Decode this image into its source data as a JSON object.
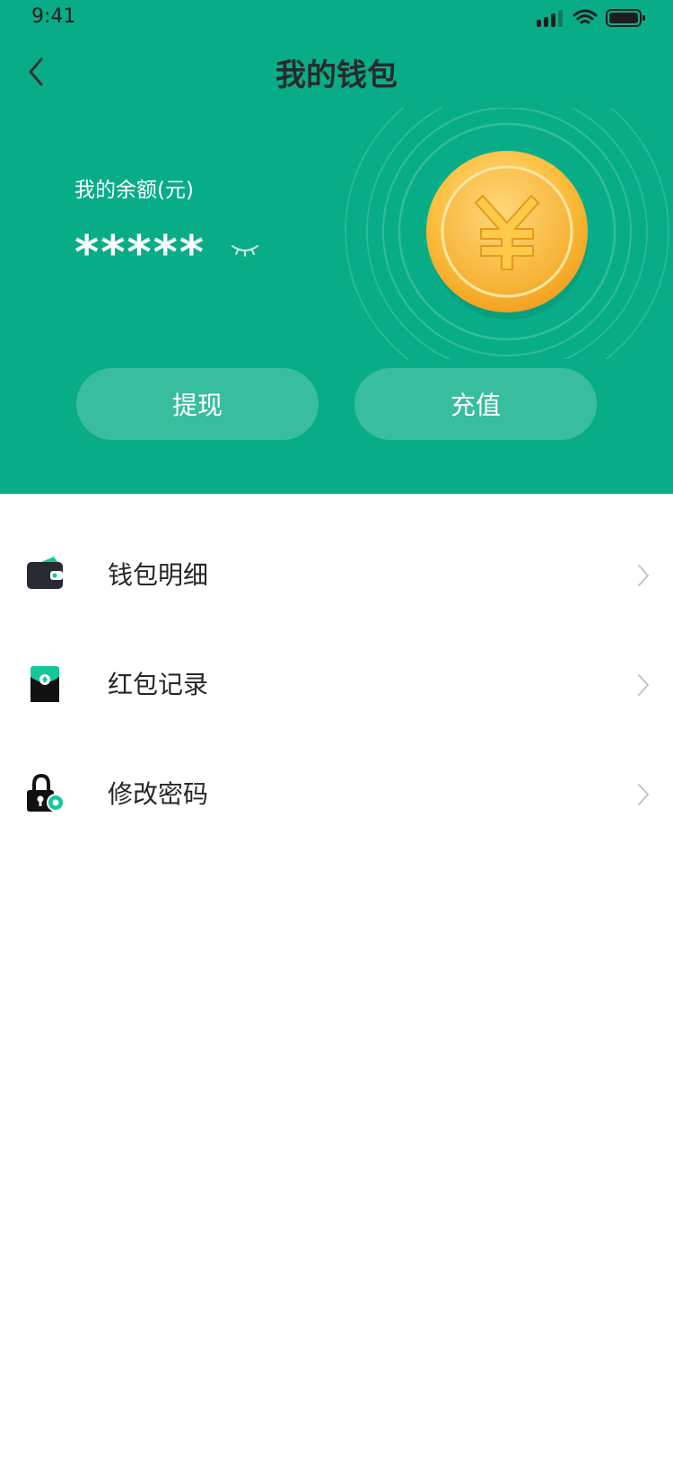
{
  "status_bar": {
    "time": "9:41"
  },
  "header": {
    "title": "我的钱包",
    "balance_label": "我的余额(元)",
    "balance_masked": "*****",
    "bg_color": "#08ad88"
  },
  "actions": {
    "withdraw_label": "提现",
    "recharge_label": "充值"
  },
  "menu": {
    "items": [
      {
        "label": "钱包明细",
        "icon": "wallet-icon"
      },
      {
        "label": "红包记录",
        "icon": "red-envelope-icon"
      },
      {
        "label": "修改密码",
        "icon": "lock-settings-icon"
      }
    ]
  },
  "colors": {
    "accent": "#08ad88",
    "coin": "#f9b632",
    "text_dark": "#262626"
  }
}
